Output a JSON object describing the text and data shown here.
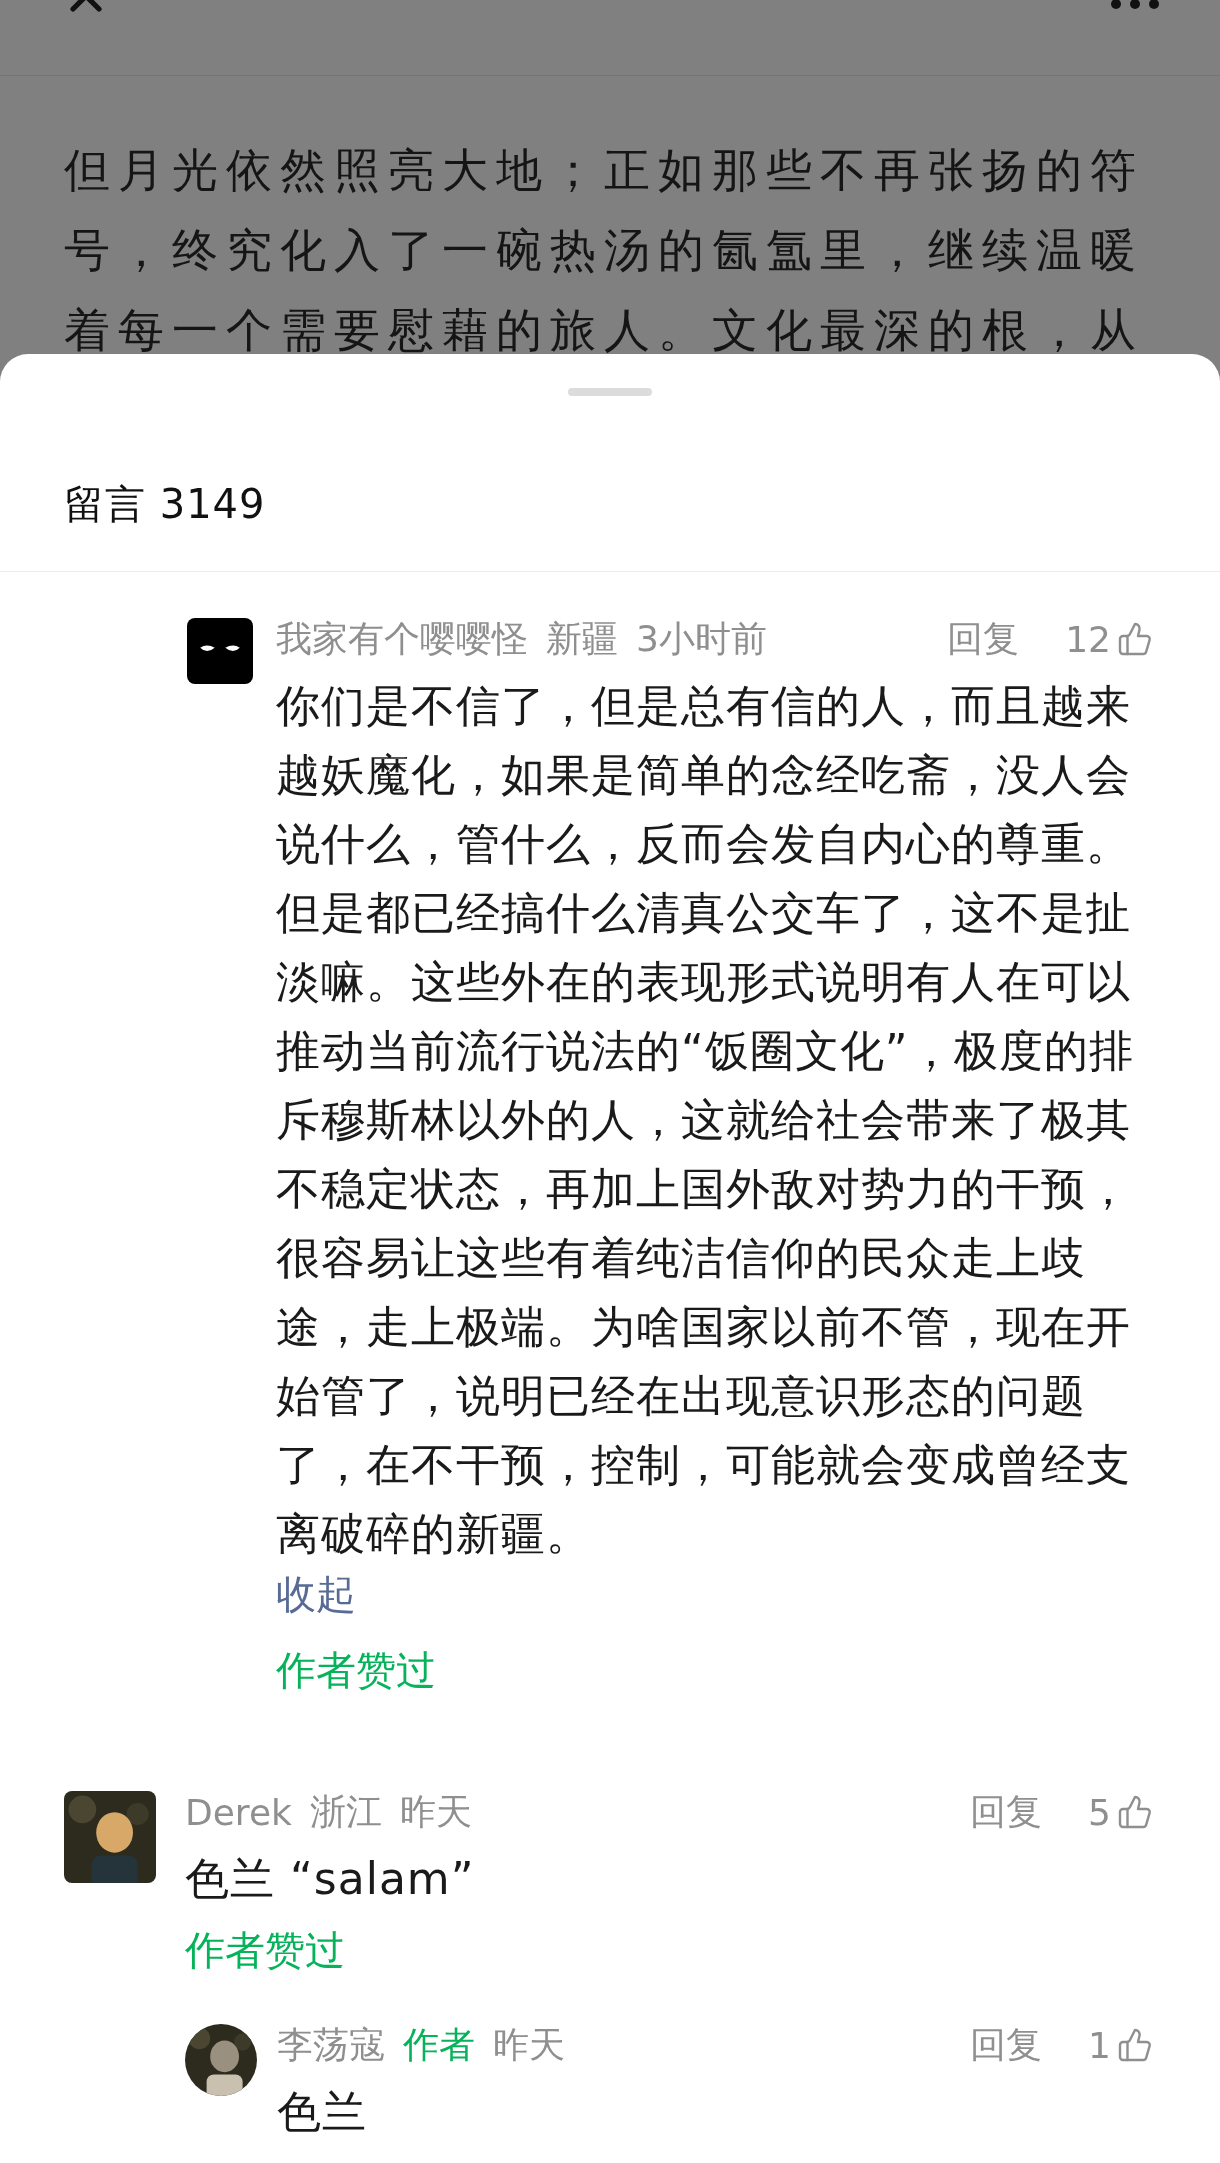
{
  "article": {
    "lines": [
      "但月光依然照亮大地；正如那些不再张扬的符",
      "号，终究化入了一碗热汤的氤氲里，继续温暖",
      "着每一个需要慰藉的旅人。文化最深的根，从"
    ]
  },
  "comments_panel": {
    "title": "留言 3149",
    "comments": [
      {
        "name": "我家有个嘤嘤怪",
        "region": "新疆",
        "time": "3小时前",
        "reply_label": "回复",
        "likes": "12",
        "body": "你们是不信了，但是总有信的人，而且越来越妖魔化，如果是简单的念经吃斋，没人会说什么，管什么，反而会发自内心的尊重。但是都已经搞什么清真公交车了，这不是扯淡嘛。这些外在的表现形式说明有人在可以推动当前流行说法的“饭圈文化”，极度的排斥穆斯林以外的人，这就给社会带来了极其不稳定状态，再加上国外敌对势力的干预，很容易让这些有着纯洁信仰的民众走上歧途，走上极端。为啥国家以前不管，现在开始管了，说明已经在出现意识形态的问题了，在不干预，控制，可能就会变成曾经支离破碎的新疆。",
        "collapse": "收起",
        "author_liked": "作者赞过"
      },
      {
        "name": "Derek",
        "region": "浙江",
        "time": "昨天",
        "reply_label": "回复",
        "likes": "5",
        "body": "色兰 “salam”",
        "author_liked": "作者赞过",
        "replies": [
          {
            "name": "李荡寇",
            "badge": "作者",
            "time": "昨天",
            "reply_label": "回复",
            "likes": "1",
            "body": "色兰"
          }
        ]
      }
    ]
  }
}
